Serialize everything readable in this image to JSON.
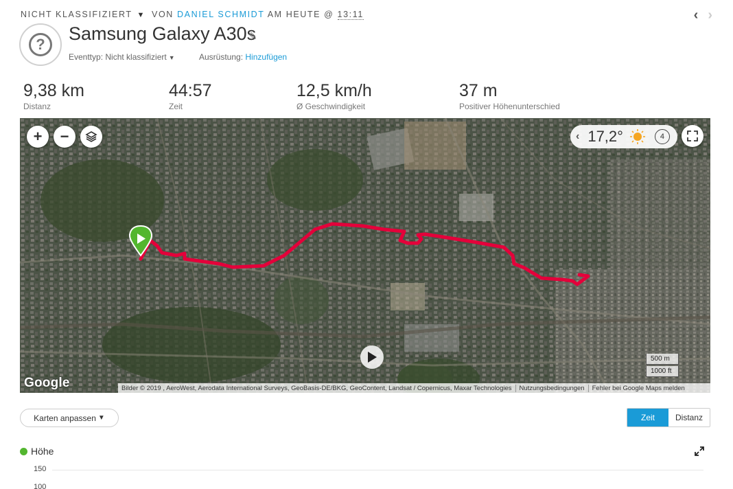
{
  "breadcrumb": {
    "category": "NICHT KLASSIFIZIERT",
    "caret": "▼",
    "by_label": "VON",
    "user": "DANIEL SCHMIDT",
    "date_label": "AM HEUTE @",
    "time": "13:11"
  },
  "nav": {
    "prev": "‹",
    "next": "›"
  },
  "activity": {
    "title": "Samsung Galaxy A30s",
    "icon_glyph": "?",
    "event_type_label": "Eventtyp:",
    "event_type_value": "Nicht klassifiziert",
    "equipment_label": "Ausrüstung:",
    "equipment_link": "Hinzufügen"
  },
  "stats": [
    {
      "value": "9,38 km",
      "label": "Distanz"
    },
    {
      "value": "44:57",
      "label": "Zeit"
    },
    {
      "value": "12,5 km/h",
      "label": "Ø Geschwindigkeit"
    },
    {
      "value": "37 m",
      "label": "Positiver Höhenunterschied"
    }
  ],
  "map": {
    "zoom_in": "+",
    "zoom_out": "−",
    "temperature": "17,2°",
    "wind_value": "4",
    "google_logo": "Google",
    "scale_metric": "500 m",
    "scale_imperial": "1000 ft",
    "attribution": "Bilder © 2019 , AeroWest, Aerodata International Surveys, GeoBasis-DE/BKG, GeoContent, Landsat / Copernicus, Maxar Technologies",
    "terms": "Nutzungsbedingungen",
    "report": "Fehler bei Google Maps melden",
    "route_color": "#e4003a"
  },
  "controls": {
    "karten_label": "Karten anpassen",
    "karten_caret": "▼",
    "toggle_time": "Zeit",
    "toggle_distance": "Distanz"
  },
  "elevation": {
    "title": "Höhe",
    "y_ticks": [
      "150",
      "100"
    ],
    "series_color": "#53b62f"
  }
}
